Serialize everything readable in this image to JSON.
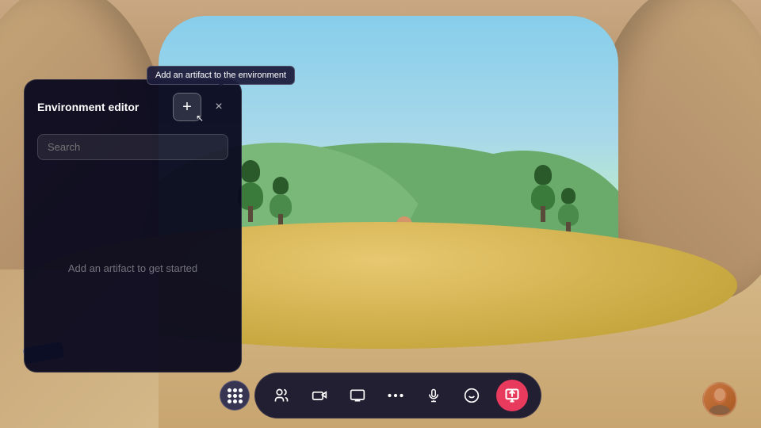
{
  "environment": {
    "background_description": "VR meeting room with archway view to outdoor landscape"
  },
  "tooltip": {
    "text": "Add an artifact to the environment"
  },
  "panel": {
    "title": "Environment editor",
    "search_placeholder": "Search",
    "empty_message": "Add an artifact to get started",
    "add_button_label": "+",
    "close_button_label": "×"
  },
  "toolbar": {
    "grid_icon": "⠿",
    "people_icon": "👥",
    "video_icon": "🎬",
    "screen_icon": "💻",
    "more_icon": "···",
    "mic_icon": "🎤",
    "emoji_icon": "😊",
    "share_icon": "📤"
  },
  "icons": {
    "close": "✕",
    "plus": "+",
    "mic": "mic",
    "camera": "cam",
    "share": "share",
    "people": "people",
    "dots": "...",
    "emoji": "emoji"
  }
}
